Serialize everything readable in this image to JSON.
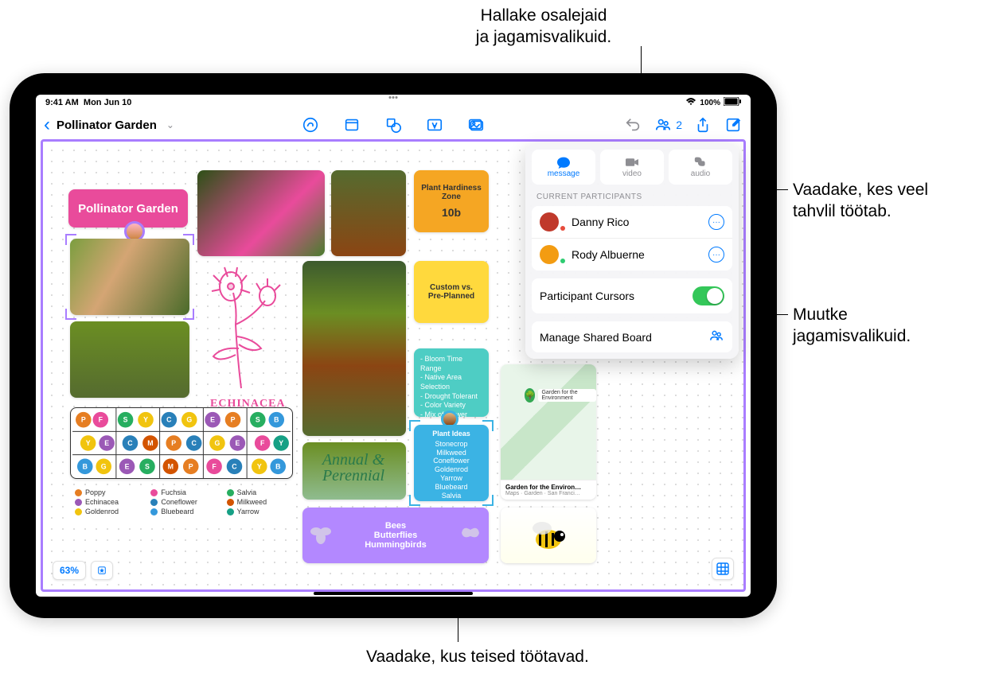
{
  "callouts": {
    "top": "Hallake osalejaid\nja jagamisvalikuid.",
    "right1": "Vaadake, kes veel\ntahvlil töötab.",
    "right2": "Muutke\njagamisvalikuid.",
    "bottom": "Vaadake, kus teised töötavad."
  },
  "statusbar": {
    "time": "9:41 AM",
    "date": "Mon Jun 10",
    "battery": "100%"
  },
  "topbar": {
    "title": "Pollinator Garden",
    "collab_count": "2"
  },
  "canvas": {
    "pink_title": "Pollinator Garden",
    "echinacea": "ECHINACEA",
    "annual": "Annual &\nPerennial",
    "orange_note_title": "Plant Hardiness Zone",
    "orange_note_value": "10b",
    "yellow_note": "Custom vs.\nPre-Planned",
    "green_note": {
      "items": [
        "Bloom Time Range",
        "Native Area Selection",
        "Drought Tolerant",
        "Color Variety",
        "Mix of Flower Struc"
      ]
    },
    "blue_note": {
      "title": "Plant Ideas",
      "items": [
        "Stonecrop",
        "Milkweed",
        "Coneflower",
        "Goldenrod",
        "Yarrow",
        "Bluebeard",
        "Salvia"
      ]
    },
    "purple_note": "Bees\nButterflies\nHummingbirds",
    "map": {
      "pin": "Garden for the Environment",
      "footer_title": "Garden for the Environ…",
      "footer_sub": "Maps · Garden · San Franci…"
    },
    "legend": [
      {
        "c": "#e67e22",
        "t": "Poppy"
      },
      {
        "c": "#e94b9b",
        "t": "Fuchsia"
      },
      {
        "c": "#27ae60",
        "t": "Salvia"
      },
      {
        "c": "#9b59b6",
        "t": "Echinacea"
      },
      {
        "c": "#2980b9",
        "t": "Coneflower"
      },
      {
        "c": "#d35400",
        "t": "Milkweed"
      },
      {
        "c": "#f1c40f",
        "t": "Goldenrod"
      },
      {
        "c": "#3498db",
        "t": "Bluebeard"
      },
      {
        "c": "#16a085",
        "t": "Yarrow"
      }
    ],
    "zoom": "63%"
  },
  "popover": {
    "tabs": {
      "message": "message",
      "video": "video",
      "audio": "audio"
    },
    "section_label": "CURRENT PARTICIPANTS",
    "participants": [
      {
        "name": "Danny Rico",
        "avatar": "#c0392b",
        "dot": "#e74c3c"
      },
      {
        "name": "Rody Albuerne",
        "avatar": "#f39c12",
        "dot": "#2ecc71"
      }
    ],
    "cursors_label": "Participant Cursors",
    "manage_label": "Manage Shared Board"
  }
}
